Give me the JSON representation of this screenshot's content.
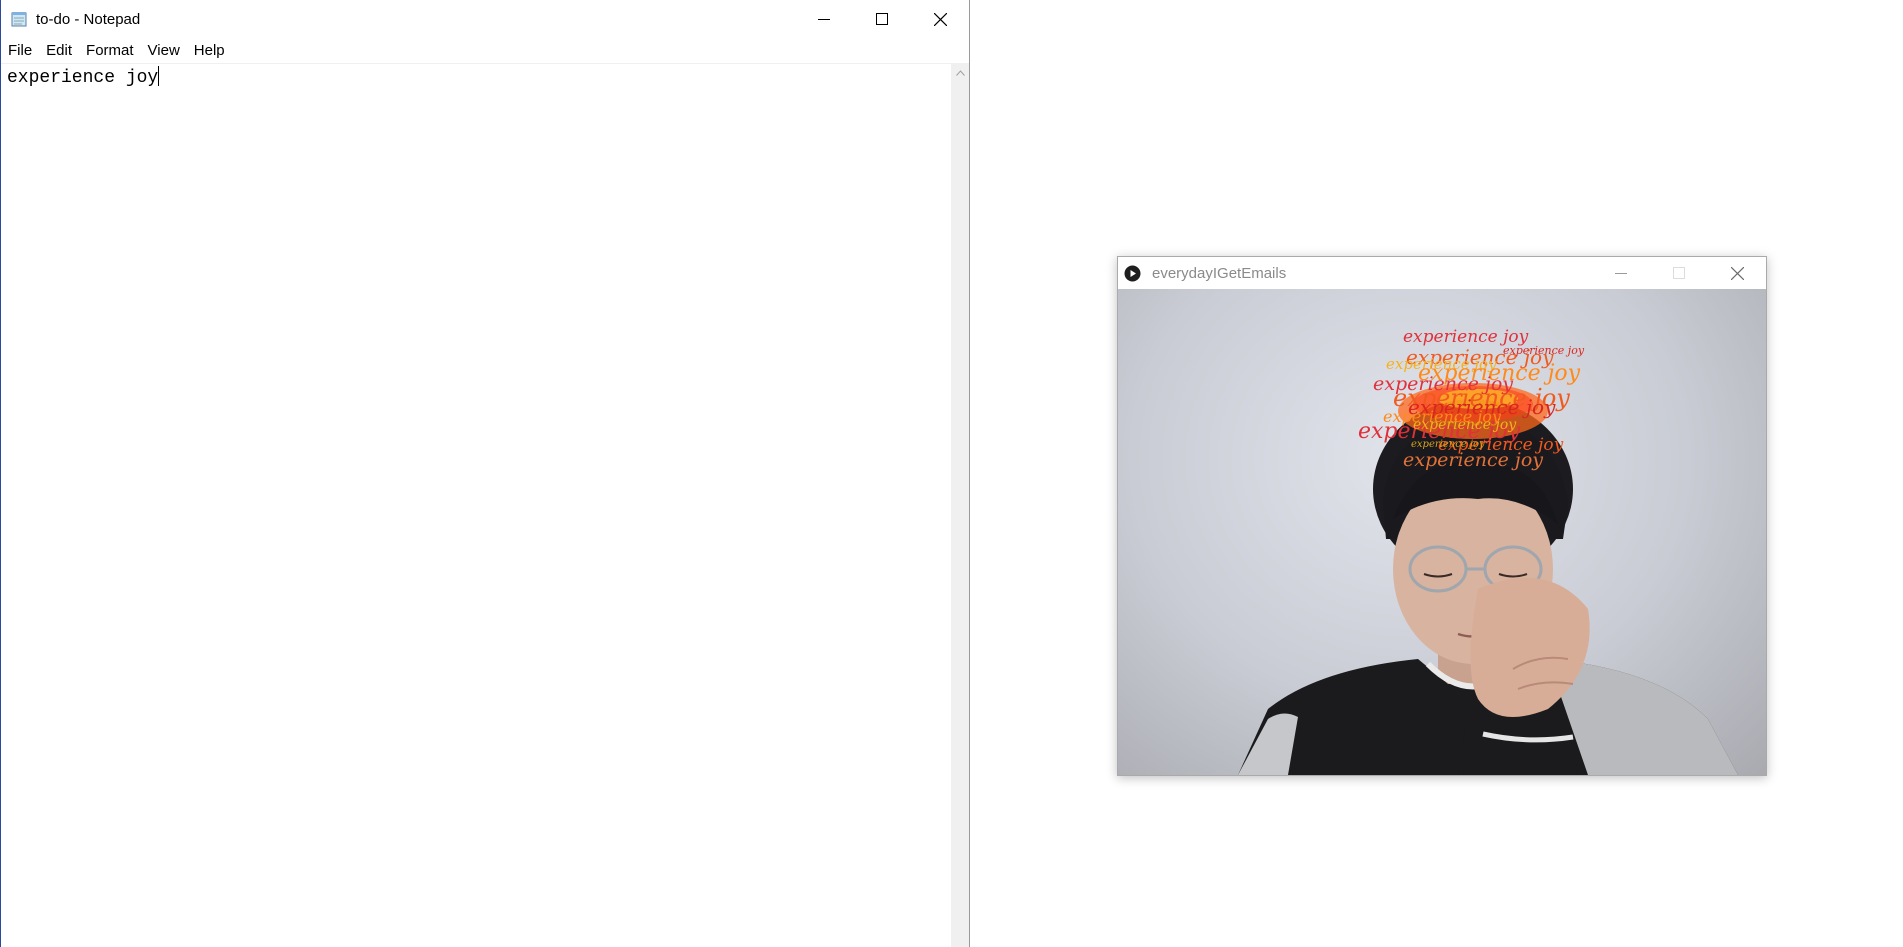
{
  "notepad": {
    "title": "to-do - Notepad",
    "menu": [
      "File",
      "Edit",
      "Format",
      "View",
      "Help"
    ],
    "content": "experience joy"
  },
  "sketch": {
    "title": "everydayIGetEmails",
    "overlay_text": "experience joy",
    "overlay_colors": [
      "#e0303a",
      "#f05a1e",
      "#ff8a1a",
      "#f5b21c",
      "#d8261e"
    ]
  },
  "icons": {
    "notepad_app": "notepad-icon",
    "sketch_app": "processing-play-icon",
    "minimize": "minimize-icon",
    "maximize": "maximize-icon",
    "close": "close-icon",
    "scroll_up": "scroll-up-arrow-icon"
  }
}
